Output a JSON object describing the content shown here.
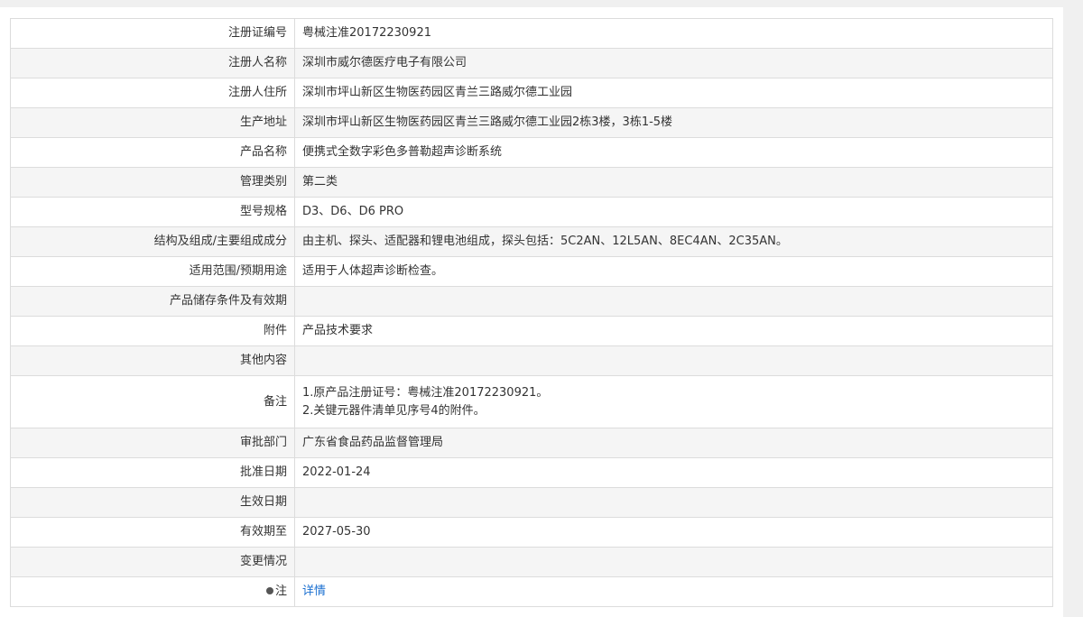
{
  "rows": [
    {
      "label": "注册证编号",
      "value": "粤械注准20172230921"
    },
    {
      "label": "注册人名称",
      "value": "深圳市威尔德医疗电子有限公司"
    },
    {
      "label": "注册人住所",
      "value": "深圳市坪山新区生物医药园区青兰三路威尔德工业园"
    },
    {
      "label": "生产地址",
      "value": "深圳市坪山新区生物医药园区青兰三路威尔德工业园2栋3楼，3栋1-5楼"
    },
    {
      "label": "产品名称",
      "value": "便携式全数字彩色多普勒超声诊断系统"
    },
    {
      "label": "管理类别",
      "value": "第二类"
    },
    {
      "label": "型号规格",
      "value": "D3、D6、D6 PRO"
    },
    {
      "label": "结构及组成/主要组成成分",
      "value": "由主机、探头、适配器和锂电池组成，探头包括：5C2AN、12L5AN、8EC4AN、2C35AN。"
    },
    {
      "label": "适用范围/预期用途",
      "value": "适用于人体超声诊断检查。"
    },
    {
      "label": "产品储存条件及有效期",
      "value": ""
    },
    {
      "label": "附件",
      "value": "产品技术要求"
    },
    {
      "label": "其他内容",
      "value": ""
    },
    {
      "label": "备注",
      "lines": [
        "1.原产品注册证号：粤械注准20172230921。",
        "2.关键元器件清单见序号4的附件。"
      ]
    },
    {
      "label": "审批部门",
      "value": "广东省食品药品监督管理局"
    },
    {
      "label": "批准日期",
      "value": "2022-01-24"
    },
    {
      "label": "生效日期",
      "value": ""
    },
    {
      "label": "有效期至",
      "value": "2027-05-30"
    },
    {
      "label": "变更情况",
      "value": ""
    },
    {
      "label": "注",
      "value": "详情",
      "icon": "pin-icon"
    }
  ]
}
